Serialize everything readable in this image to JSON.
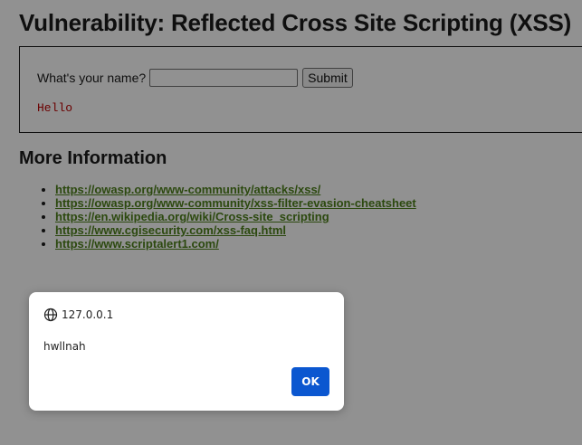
{
  "page": {
    "title": "Vulnerability: Reflected Cross Site Scripting (XSS)"
  },
  "form": {
    "label": "What's your name?",
    "input_value": "",
    "submit_label": "Submit",
    "output": "Hello"
  },
  "more_info": {
    "title": "More Information",
    "links": [
      "https://owasp.org/www-community/attacks/xss/",
      "https://owasp.org/www-community/xss-filter-evasion-cheatsheet",
      "https://en.wikipedia.org/wiki/Cross-site_scripting",
      "https://www.cgisecurity.com/xss-faq.html",
      "https://www.scriptalert1.com/"
    ]
  },
  "dialog": {
    "origin": "127.0.0.1",
    "message": "hwllnah",
    "ok_label": "OK",
    "icon": "globe-icon"
  },
  "colors": {
    "link": "#4a7a1a",
    "output_text": "#b30000",
    "ok_button": "#0b57d0"
  }
}
